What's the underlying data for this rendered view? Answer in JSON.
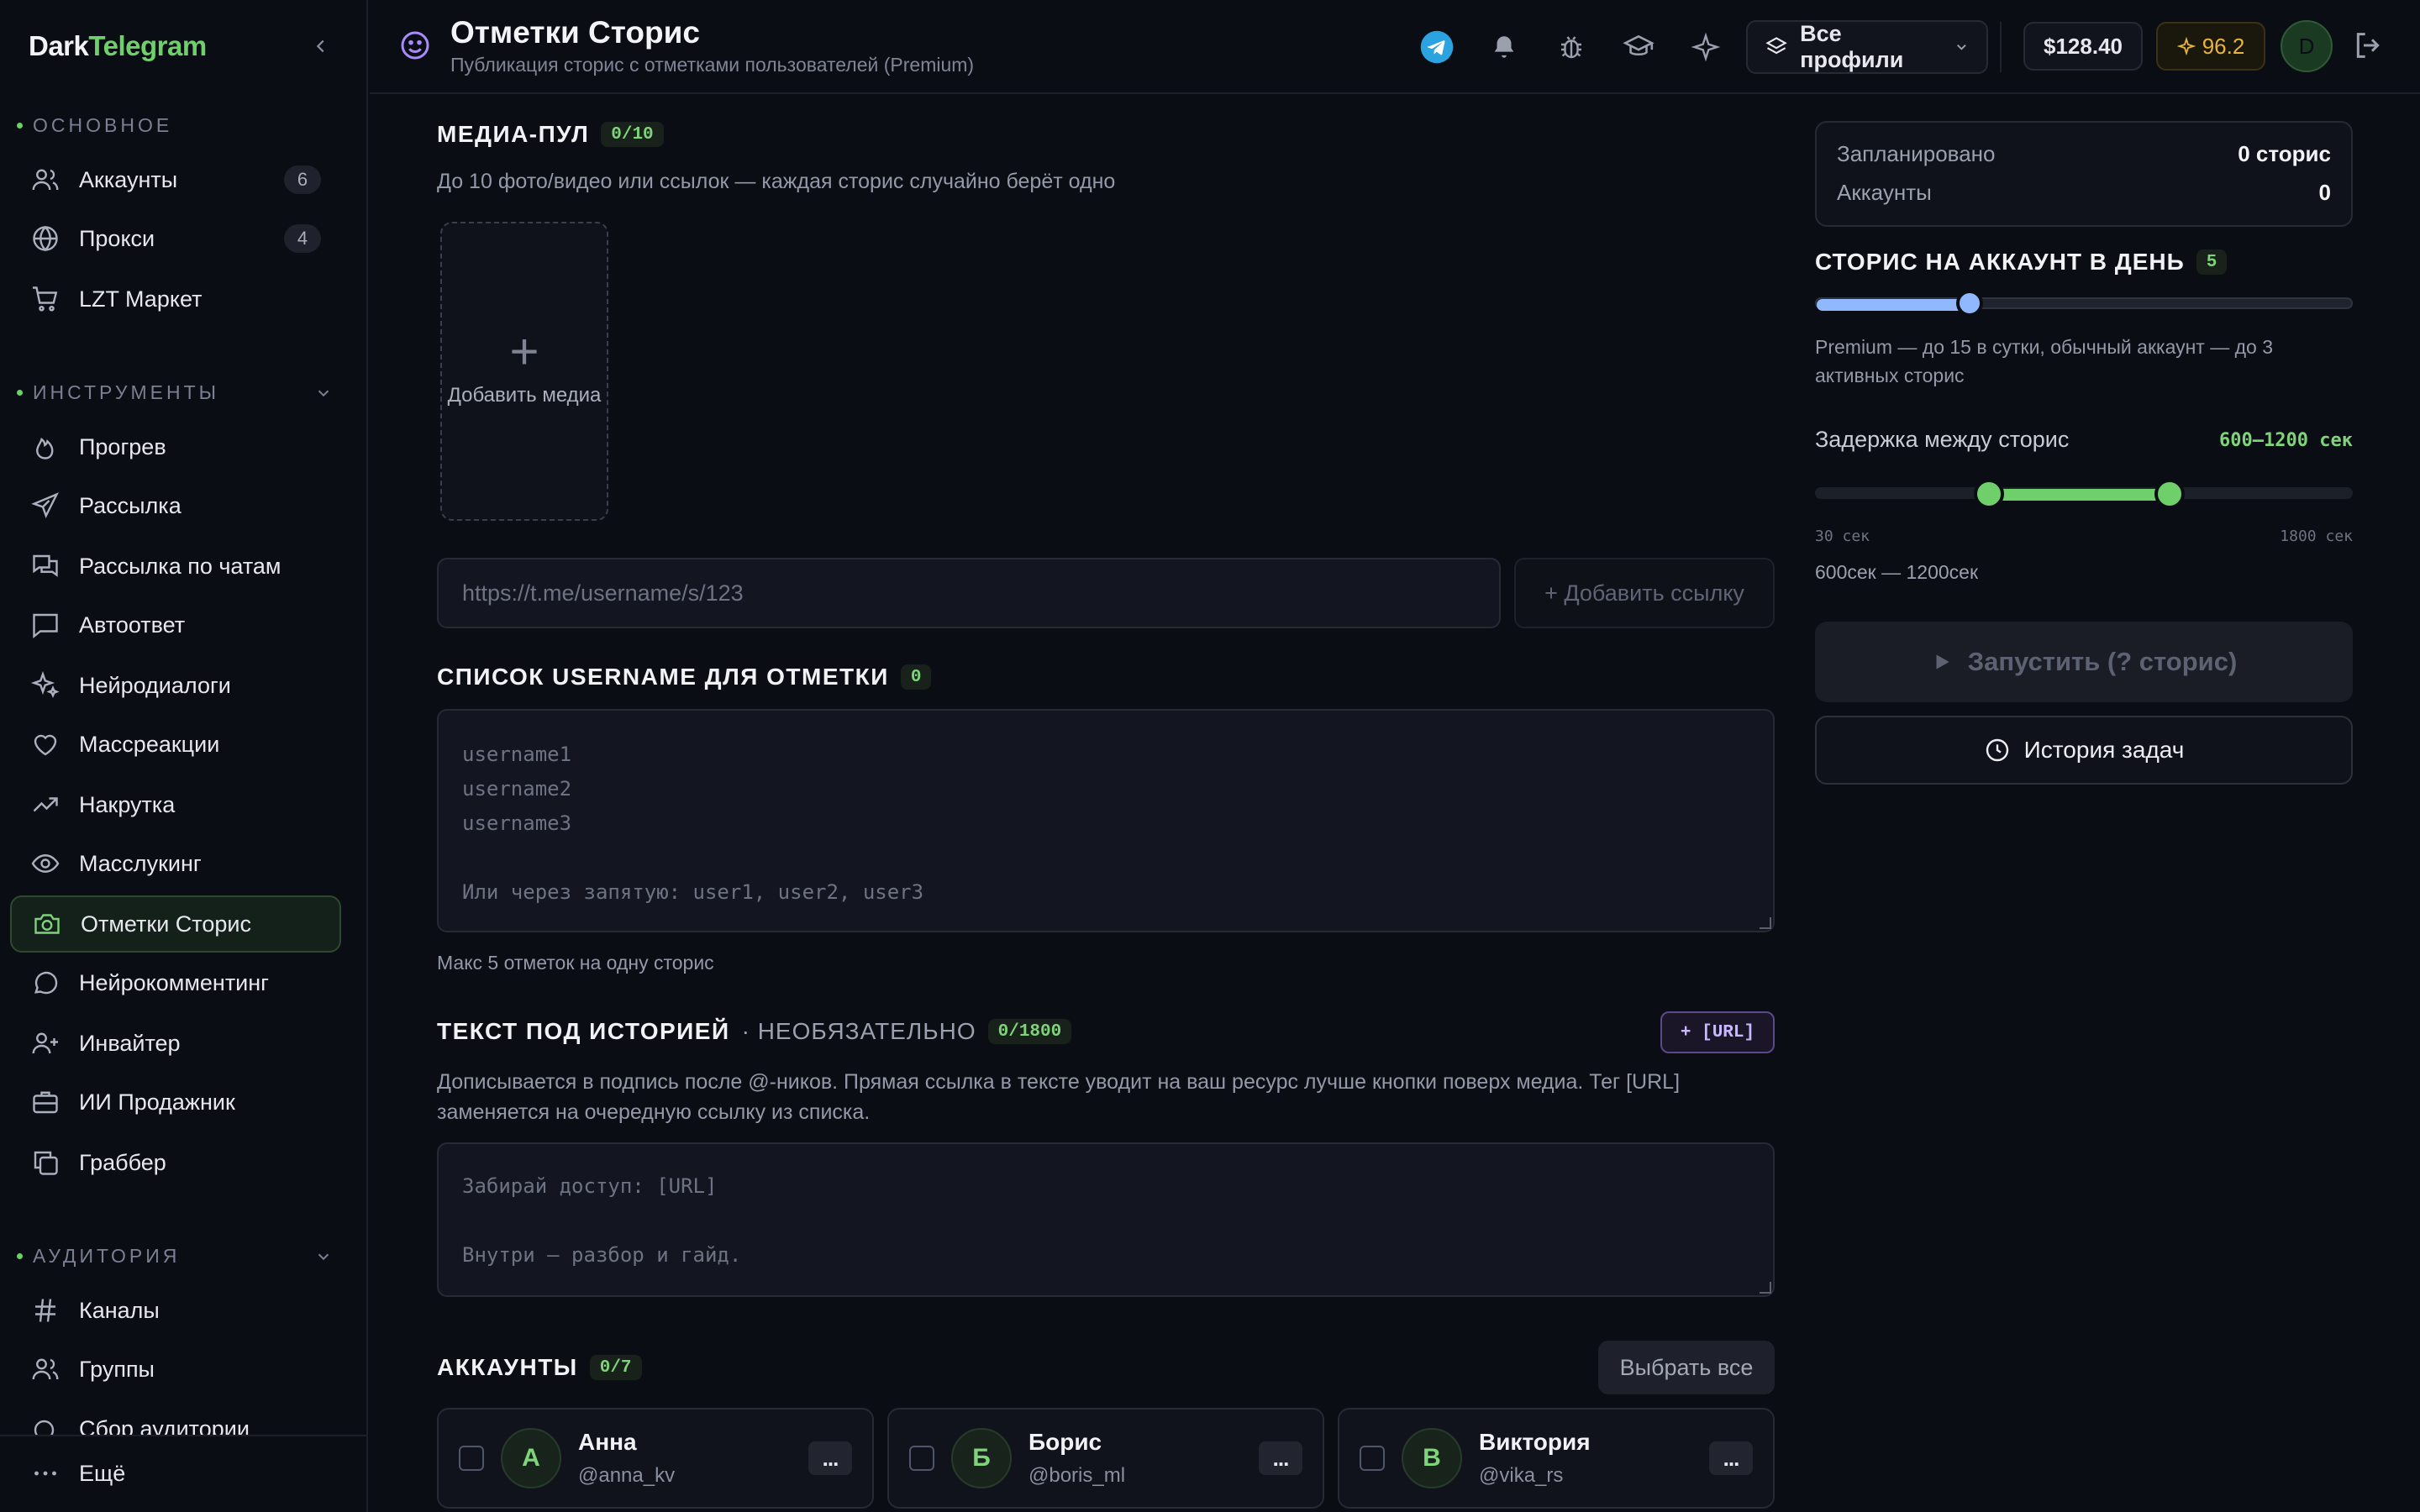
{
  "brand": {
    "dark": "Dark",
    "tg": "Telegram"
  },
  "sidebar": {
    "sections": [
      {
        "label": "ОСНОВНОЕ"
      },
      {
        "label": "ИНСТРУМЕНТЫ"
      },
      {
        "label": "АУДИТОРИЯ"
      }
    ],
    "main_items": [
      {
        "label": "Аккаунты",
        "badge": "6",
        "icon": "users-icon"
      },
      {
        "label": "Прокси",
        "badge": "4",
        "icon": "globe-icon"
      },
      {
        "label": "LZT Маркет",
        "icon": "cart-icon"
      }
    ],
    "tool_items": [
      {
        "label": "Прогрев",
        "icon": "flame-icon"
      },
      {
        "label": "Рассылка",
        "icon": "send-icon"
      },
      {
        "label": "Рассылка по чатам",
        "icon": "chats-icon"
      },
      {
        "label": "Автоответ",
        "icon": "message-square-icon"
      },
      {
        "label": "Нейродиалоги",
        "icon": "sparkles-icon"
      },
      {
        "label": "Массреакции",
        "icon": "heart-icon"
      },
      {
        "label": "Накрутка",
        "icon": "trending-up-icon"
      },
      {
        "label": "Масслукинг",
        "icon": "eye-icon"
      },
      {
        "label": "Отметки Сторис",
        "icon": "camera-icon"
      },
      {
        "label": "Нейрокомментинг",
        "icon": "message-circle-icon"
      },
      {
        "label": "Инвайтер",
        "icon": "user-plus-icon"
      },
      {
        "label": "ИИ Продажник",
        "icon": "briefcase-icon"
      },
      {
        "label": "Граббер",
        "icon": "copy-icon"
      }
    ],
    "audience_items": [
      {
        "label": "Каналы",
        "icon": "hash-icon"
      },
      {
        "label": "Группы",
        "icon": "users-icon"
      },
      {
        "label": "Сбор аудитории",
        "icon": "search-icon"
      }
    ],
    "more_label": "Ещё"
  },
  "header": {
    "title": "Отметки Сторис",
    "subtitle": "Публикация сторис с отметками пользователей (Premium)",
    "profile_select": "Все профили",
    "balance": "$128.40",
    "rating": "96.2",
    "avatar_letter": "D"
  },
  "media": {
    "title": "МЕДИА-ПУЛ",
    "count": "0/10",
    "hint": "До 10 фото/видео или ссылок — каждая сторис случайно берёт одно",
    "add_label": "Добавить медиа",
    "url_placeholder": "https://t.me/username/s/123",
    "add_link_label": "+ Добавить ссылку"
  },
  "usernames": {
    "title": "СПИСОК USERNAME ДЛЯ ОТМЕТКИ",
    "count": "0",
    "placeholder": "username1\nusername2\nusername3\n\nИли через запятую: user1, user2, user3",
    "hint": "Макс 5 отметок на одну сторис"
  },
  "caption": {
    "title": "ТЕКСТ ПОД ИСТОРИЕЙ",
    "optional": "· НЕОБЯЗАТЕЛЬНО",
    "count": "0/1800",
    "url_tag": "+ [URL]",
    "hint": "Дописывается в подпись после @-ников. Прямая ссылка в тексте уводит на ваш ресурс лучше кнопки поверх медиа. Тег [URL] заменяется на очередную ссылку из списка.",
    "placeholder": "Забирай доступ: [URL]\n\nВнутри — разбор и гайд."
  },
  "accounts": {
    "title": "АККАУНТЫ",
    "count": "0/7",
    "select_all": "Выбрать все",
    "items": [
      {
        "letter": "А",
        "name": "Анна",
        "handle": "@anna_kv"
      },
      {
        "letter": "Б",
        "name": "Борис",
        "handle": "@boris_ml"
      },
      {
        "letter": "В",
        "name": "Виктория",
        "handle": "@vika_rs"
      }
    ],
    "menu": "..."
  },
  "summary": {
    "planned_label": "Запланировано",
    "planned_value": "0 сторис",
    "accounts_label": "Аккаунты",
    "accounts_value": "0"
  },
  "per_day": {
    "title": "СТОРИС НА АККАУНТ В ДЕНЬ",
    "value": 5,
    "max": 15,
    "hint": "Premium — до 15 в сутки, обычный аккаунт — до 3 активных сторис"
  },
  "delay": {
    "title": "Задержка между сторис",
    "value_label": "600–1200 сек",
    "min_label": "30 сек",
    "max_label": "1800 сек",
    "range_min": 30,
    "range_max": 1800,
    "low": 600,
    "high": 1200,
    "summary": "600сек — 1200сек"
  },
  "actions": {
    "run_label": "Запустить (? сторис)",
    "history_label": "История задач"
  },
  "colors": {
    "accent": "#6fcf6a",
    "slider_blue": "#8fb8ff",
    "telegram": "#2aa3e0",
    "gold": "#e8b43c"
  }
}
